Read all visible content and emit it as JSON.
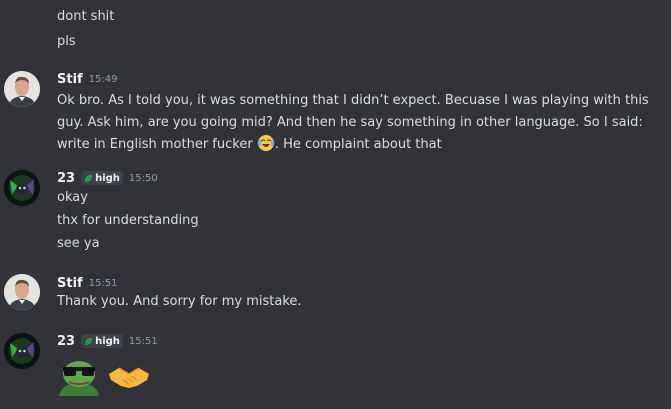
{
  "colors": {
    "background": "#313338",
    "text": "#dbdee1",
    "username": "#f2f3f5",
    "timestamp": "#949ba4",
    "tag_bg": "#3f4248",
    "leaf": "#23a55a"
  },
  "messages": [
    {
      "id": "cont1",
      "lines": [
        "dont shit",
        "pls"
      ]
    },
    {
      "id": "stif1",
      "author": "Stif",
      "time": "15:49",
      "text_a": "Ok bro. As I told you, it was something that I didn’t expect. Becuase I was playing with this guy. Ask him, are you going mid? And then he say something in other language. So I said: write in English mother fucker ",
      "emoji": "face-with-tears-of-joy",
      "text_b": ". He complaint about that"
    },
    {
      "id": "g23a",
      "author": "23",
      "tag": "high",
      "time": "15:50",
      "lines": [
        "okay",
        "thx for understanding",
        "see ya"
      ]
    },
    {
      "id": "stif2",
      "author": "Stif",
      "time": "15:51",
      "lines": [
        "Thank you. And sorry for my mistake."
      ]
    },
    {
      "id": "g23b",
      "author": "23",
      "tag": "high",
      "time": "15:51",
      "emojis": [
        "pepe-sunglasses-emoji",
        "handshake-emoji"
      ]
    }
  ]
}
